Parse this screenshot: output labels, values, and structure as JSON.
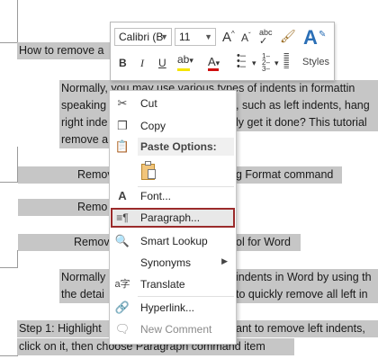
{
  "document": {
    "lines": [
      {
        "text": "How to remove a"
      },
      {
        "text": "Normally, you may use various types of indents in formattin"
      },
      {
        "text": "speaking"
      },
      {
        "text": ", such as left indents, hang"
      },
      {
        "text": "right inde"
      },
      {
        "text": "ly get it done? This tutorial"
      },
      {
        "text": "remove a"
      },
      {
        "text": "Remov"
      },
      {
        "text": "g Format command"
      },
      {
        "text": "Remo"
      },
      {
        "text": "Remov"
      },
      {
        "text": "ol for Word"
      },
      {
        "text": "Normally"
      },
      {
        "text": "indents in Word by using th"
      },
      {
        "text": "the detai"
      },
      {
        "text": "to quickly remove all left in"
      },
      {
        "text": "Step 1: Highlight"
      },
      {
        "text": "ant to remove left indents,"
      },
      {
        "text": "click on it, then choose Paragraph command item"
      }
    ]
  },
  "mini_toolbar": {
    "font_name": "Calibri (B",
    "font_size": "11",
    "grow_font": "A",
    "shrink_font": "A",
    "change_case": "abc",
    "bold": "B",
    "italic": "I",
    "underline": "U",
    "highlight_color": "#f5e400",
    "font_color": "#d01010",
    "styles_label": "Styles"
  },
  "context_menu": {
    "items": [
      {
        "label": "Cut",
        "icon": "scissors-icon",
        "disabled": false
      },
      {
        "label": "Copy",
        "icon": "copy-icon",
        "disabled": false
      },
      {
        "label": "Paste Options:",
        "icon": "paste-icon",
        "disabled": false
      },
      {
        "label": "Font...",
        "icon": "font-icon",
        "disabled": false
      },
      {
        "label": "Paragraph...",
        "icon": "paragraph-icon",
        "disabled": false,
        "highlighted": true
      },
      {
        "label": "Smart Lookup",
        "icon": "search-icon",
        "disabled": false
      },
      {
        "label": "Synonyms",
        "icon": "",
        "disabled": false,
        "submenu": true
      },
      {
        "label": "Translate",
        "icon": "translate-icon",
        "disabled": false
      },
      {
        "label": "Hyperlink...",
        "icon": "hyperlink-icon",
        "disabled": false
      },
      {
        "label": "New Comment",
        "icon": "comment-icon",
        "disabled": true
      }
    ]
  },
  "colors": {
    "selection": "#c6c6c6",
    "highlight_border": "#9b2b2b",
    "styles_accent": "#2b6fb6"
  }
}
